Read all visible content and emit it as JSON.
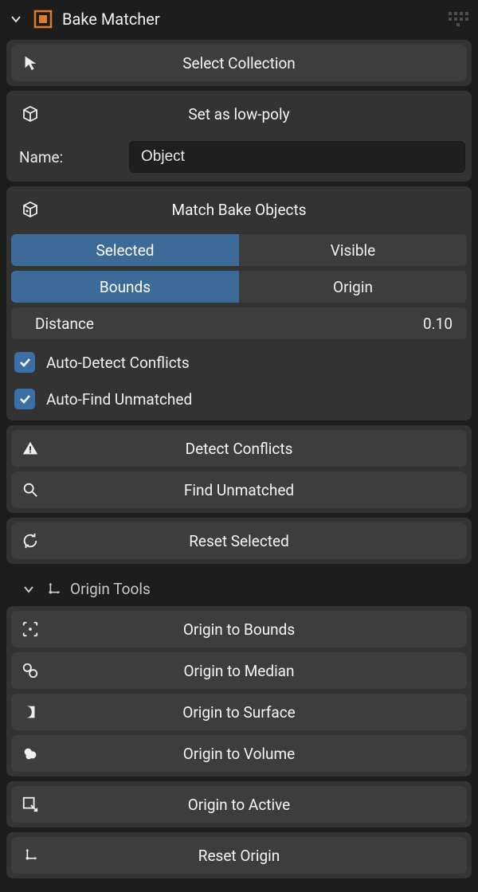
{
  "panel": {
    "title": "Bake Matcher"
  },
  "section1": {
    "select_collection": "Select Collection"
  },
  "section2": {
    "header": "Set as low-poly",
    "name_label": "Name:",
    "name_value": "Object"
  },
  "section3": {
    "header": "Match Bake Objects",
    "mode_a_left": "Selected",
    "mode_a_right": "Visible",
    "mode_b_left": "Bounds",
    "mode_b_right": "Origin",
    "distance_label": "Distance",
    "distance_value": "0.10",
    "auto_detect": "Auto-Detect Conflicts",
    "auto_find": "Auto-Find Unmatched"
  },
  "section4": {
    "detect": "Detect Conflicts",
    "find": "Find Unmatched"
  },
  "section5": {
    "reset_selected": "Reset Selected"
  },
  "origin_header": "Origin Tools",
  "origin_buttons": {
    "bounds": "Origin to Bounds",
    "median": "Origin to Median",
    "surface": "Origin to Surface",
    "volume": "Origin to Volume",
    "active": "Origin to Active",
    "reset": "Reset Origin"
  }
}
